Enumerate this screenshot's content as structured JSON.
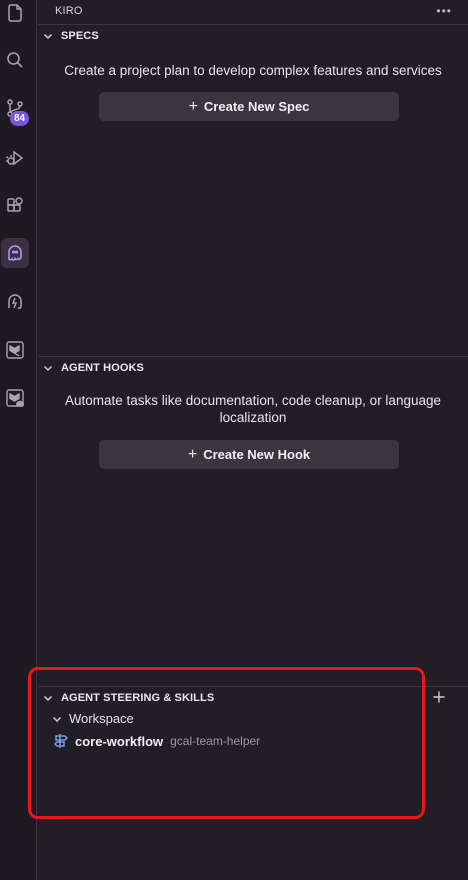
{
  "panel": {
    "title": "KIRO",
    "more_label": "•••"
  },
  "activity_bar": {
    "items": [
      {
        "name": "explorer-icon",
        "active": false
      },
      {
        "name": "search-icon",
        "active": false
      },
      {
        "name": "source-control-icon",
        "active": false
      },
      {
        "name": "run-debug-icon",
        "active": false
      },
      {
        "name": "extensions-icon",
        "active": false
      },
      {
        "name": "kiro-ghost-icon",
        "active": true
      },
      {
        "name": "kiro-powers-icon",
        "active": false
      },
      {
        "name": "terraform-icon",
        "active": false
      },
      {
        "name": "terraform-cloud-icon",
        "active": false
      }
    ],
    "source_control_badge": "84"
  },
  "specs": {
    "title": "SPECS",
    "description": "Create a project plan to develop complex features and services",
    "button_label": "Create New Spec"
  },
  "hooks": {
    "title": "AGENT HOOKS",
    "description_line1": "Automate tasks like documentation, code cleanup, or language",
    "description_line2": "localization",
    "button_label": "Create New Hook"
  },
  "steering": {
    "title": "AGENT STEERING & SKILLS",
    "group_label": "Workspace",
    "items": [
      {
        "name": "core-workflow",
        "detail": "gcal-team-helper"
      }
    ]
  },
  "highlight_color": "#e8191c"
}
